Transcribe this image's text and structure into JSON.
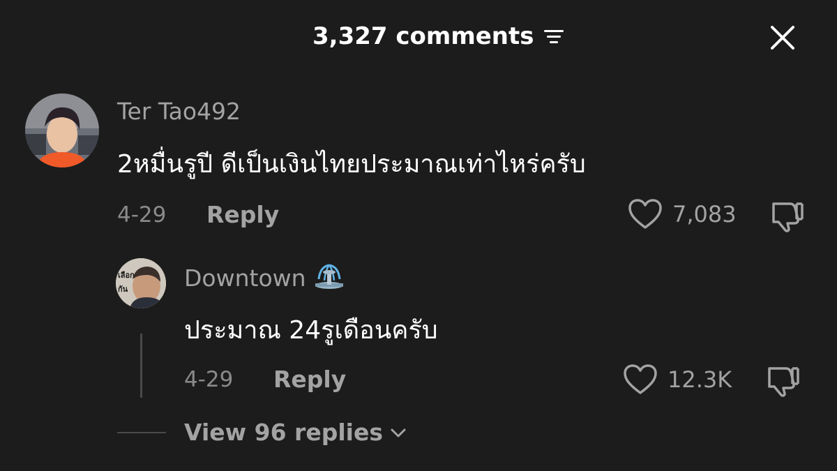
{
  "header": {
    "comment_count": "3,327 comments",
    "filter_icon": "filter-lines-icon",
    "close_icon": "close-x-icon"
  },
  "comments": [
    {
      "username": "Ter Tao492",
      "text": "2หมื่นรูปี ดีเป็นเงินไทยประมาณเท่าไหร่ครับ",
      "date": "4-29",
      "reply_label": "Reply",
      "likes": "7,083"
    }
  ],
  "reply": {
    "username": "Downtown",
    "username_emoji": "fountain-emoji",
    "text": "ประมาณ 24รูเดือนครับ",
    "date": "4-29",
    "reply_label": "Reply",
    "likes": "12.3K",
    "avatar_text": "เลือก กัน"
  },
  "view_replies": {
    "label": "View 96 replies",
    "icon": "chevron-down-icon"
  },
  "colors": {
    "background": "#1c1c1c",
    "primary_text": "#ffffff",
    "secondary_text": "#a3a3a3",
    "date_text": "#8a8a8a"
  }
}
